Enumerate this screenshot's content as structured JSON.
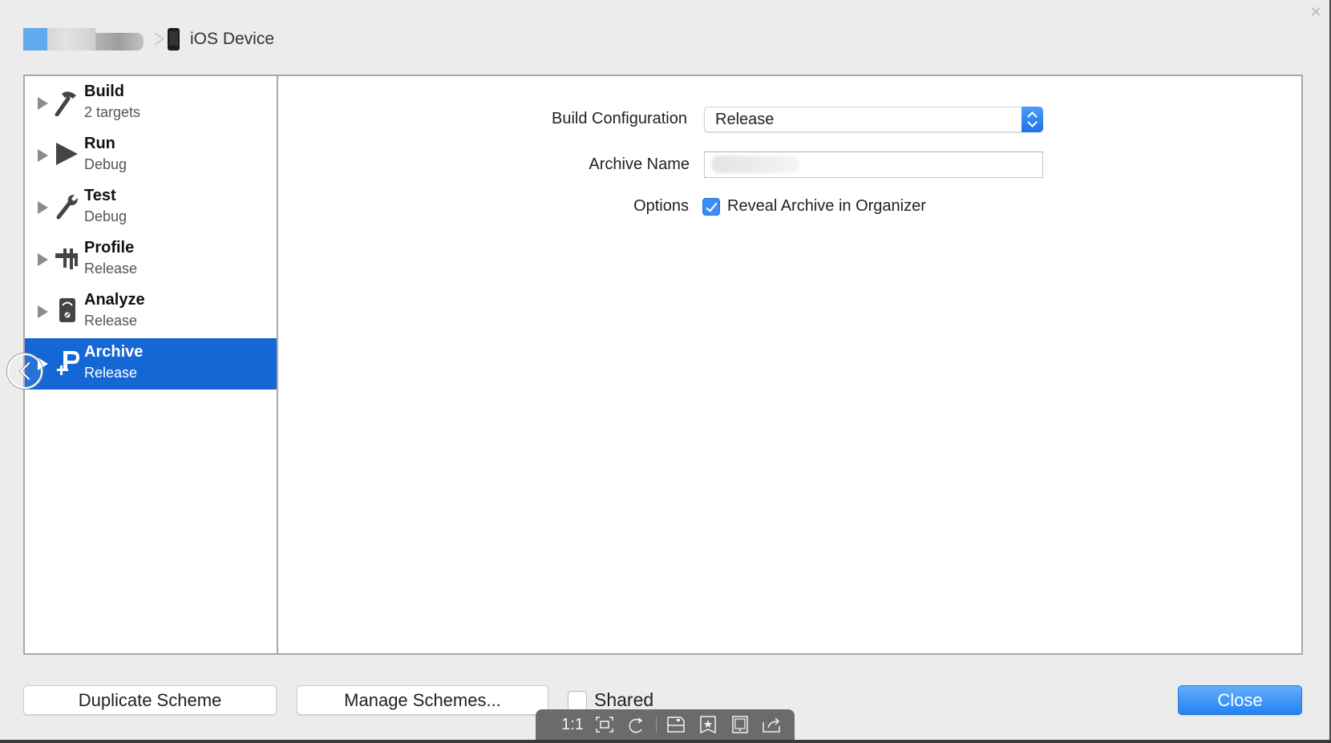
{
  "window": {
    "close_glyph": "✕"
  },
  "breadcrumb": {
    "destination": "iOS Device",
    "destination_icon": "iphone-icon",
    "separator_icon": "chevron-right-icon"
  },
  "sidebar": {
    "items": [
      {
        "title": "Build",
        "subtitle": "2 targets",
        "icon": "hammer-icon",
        "selected": false
      },
      {
        "title": "Run",
        "subtitle": "Debug",
        "icon": "play-icon",
        "selected": false
      },
      {
        "title": "Test",
        "subtitle": "Debug",
        "icon": "wrench-icon",
        "selected": false
      },
      {
        "title": "Profile",
        "subtitle": "Release",
        "icon": "caliper-icon",
        "selected": false
      },
      {
        "title": "Analyze",
        "subtitle": "Release",
        "icon": "meter-icon",
        "selected": false
      },
      {
        "title": "Archive",
        "subtitle": "Release",
        "icon": "archive-clamp-icon",
        "selected": true
      }
    ]
  },
  "form": {
    "build_configuration": {
      "label": "Build Configuration",
      "value": "Release"
    },
    "archive_name": {
      "label": "Archive Name",
      "value": ""
    },
    "options": {
      "label": "Options",
      "checkbox_label": "Reveal Archive in Organizer",
      "checked": true
    }
  },
  "footer": {
    "duplicate_label": "Duplicate Scheme",
    "manage_label": "Manage Schemes...",
    "shared_label": "Shared",
    "shared_checked": false,
    "close_label": "Close"
  },
  "viewer_toolbar": {
    "actual_size_label": "1:1",
    "items": [
      "fit-to-window-icon",
      "rotate-icon",
      "save-icon",
      "bookmark-star-icon",
      "screen-icon",
      "share-icon"
    ]
  },
  "colors": {
    "selection": "#1467d5",
    "accent": "#2482f4"
  }
}
